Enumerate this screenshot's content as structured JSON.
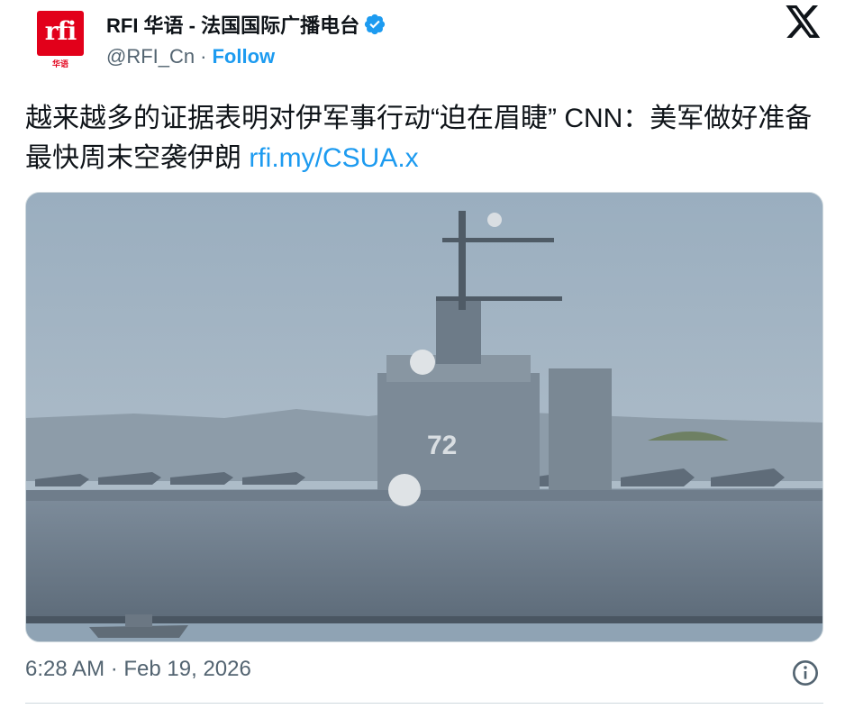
{
  "account": {
    "display_name": "RFI 华语 - 法国国际广播电台",
    "handle": "@RFI_Cn",
    "separator": "·",
    "follow_label": "Follow",
    "avatar_logo_text": "rfi",
    "avatar_sub_text": "华语",
    "verified": true
  },
  "tweet": {
    "text": "越来越多的证据表明对伊军事行动“迫在眉睫” CNN：美军做好准备最快周末空袭伊朗 ",
    "link_text": "rfi.my/CSUA.x",
    "timestamp": "6:28 AM · Feb 19, 2026"
  },
  "media": {
    "icon": "photo-aircraft-carrier",
    "hull_number": "72"
  },
  "icons": {
    "platform_logo": "x-logo-icon",
    "verified": "verified-badge-icon",
    "info": "info-icon"
  },
  "colors": {
    "link": "#1d9bf0",
    "brand_red": "#e2001a",
    "muted": "#536471",
    "text": "#0f1419"
  }
}
